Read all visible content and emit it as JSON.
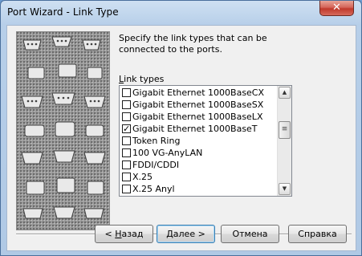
{
  "window": {
    "title": "Port Wizard - Link Type",
    "close_glyph": "✕"
  },
  "content": {
    "description": "Specify the link types that can be connected to the ports.",
    "group_label": "Link types"
  },
  "link_types": [
    {
      "label": "Gigabit Ethernet 1000BaseCX",
      "checked": false
    },
    {
      "label": "Gigabit Ethernet 1000BaseSX",
      "checked": false
    },
    {
      "label": "Gigabit Ethernet 1000BaseLX",
      "checked": false
    },
    {
      "label": "Gigabit Ethernet 1000BaseT",
      "checked": true
    },
    {
      "label": "Token Ring",
      "checked": false
    },
    {
      "label": "100 VG-AnyLAN",
      "checked": false
    },
    {
      "label": "FDDI/CDDI",
      "checked": false
    },
    {
      "label": "X.25",
      "checked": false
    },
    {
      "label": "X.25 Anyl",
      "checked": false
    }
  ],
  "scrollbar": {
    "up_glyph": "▲",
    "down_glyph": "▼",
    "thumb_glyph": "≡"
  },
  "buttons": {
    "back": "< Назад",
    "next": "Далее >",
    "cancel": "Отмена",
    "help": "Справка"
  },
  "icons": {
    "close": "close-icon",
    "checkbox": "checkbox-icon",
    "decorative_art": "wizard-banner-image"
  }
}
